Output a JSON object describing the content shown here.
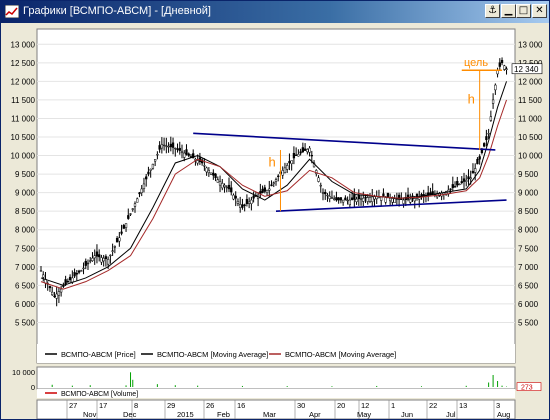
{
  "window": {
    "title": "Графики [ВСМПО-АВСМ] - [Дневной]",
    "buttons": [
      {
        "name": "pin-icon",
        "glyph": "⚓"
      },
      {
        "name": "minimize-icon",
        "glyph": "▁"
      },
      {
        "name": "maximize-icon",
        "glyph": "□"
      },
      {
        "name": "close-icon",
        "glyph": "✕"
      }
    ]
  },
  "colors": {
    "candle": "#000000",
    "ma_fast": "#000000",
    "ma_slow": "#a52a2a",
    "annotation_orange": "#ff8c00",
    "trendline": "#00008b",
    "axis": "#0000aa",
    "volume": "#00a000",
    "price_label_bg": "#ffffff"
  },
  "chart_data": [
    {
      "type": "line",
      "title": "",
      "xlabel": "",
      "ylabel": "",
      "ylim": [
        5000,
        13250
      ],
      "yticks": [
        "13 000",
        "12 500",
        "12 000",
        "11 500",
        "11 000",
        "10 500",
        "10 000",
        "9 500",
        "9 000",
        "8 500",
        "8 000",
        "7 500",
        "7 000",
        "6 500",
        "6 000",
        "5 500"
      ],
      "ytick_values": [
        13000,
        12500,
        12000,
        11500,
        11000,
        10500,
        10000,
        9500,
        9000,
        8500,
        8000,
        7500,
        7000,
        6500,
        6000,
        5500
      ],
      "last_price_label": "12 340",
      "last_price": 12340,
      "grid": true,
      "legend_position": "bottom",
      "series": [
        {
          "name": "ВСМПО-АВСМ [Price]",
          "kind": "candles",
          "x_index": [
            0,
            6,
            12,
            18,
            24,
            30,
            36,
            42,
            48,
            54,
            60,
            66,
            72,
            78,
            84,
            90,
            96,
            102,
            108,
            114,
            120,
            126,
            132,
            138,
            144,
            150,
            156,
            162,
            168,
            174,
            180,
            186,
            192,
            196,
            200,
            202,
            204,
            206,
            208
          ],
          "values": [
            6900,
            6200,
            6600,
            6900,
            7300,
            7200,
            7900,
            8700,
            9500,
            10300,
            10200,
            10000,
            9800,
            9400,
            9100,
            8600,
            8900,
            9100,
            9600,
            10000,
            10200,
            9000,
            8800,
            8800,
            8850,
            8900,
            8850,
            8800,
            8850,
            8950,
            9000,
            9200,
            9400,
            9900,
            10600,
            11500,
            12300,
            12500,
            12340
          ]
        },
        {
          "name": "ВСМПО-АВСМ [Moving Average]",
          "kind": "line",
          "x_index": [
            0,
            10,
            20,
            30,
            40,
            50,
            60,
            70,
            80,
            90,
            100,
            110,
            120,
            130,
            140,
            150,
            160,
            170,
            180,
            190,
            196,
            200,
            204,
            208
          ],
          "values": [
            6700,
            6500,
            6700,
            7000,
            7500,
            8600,
            9800,
            10000,
            9700,
            9100,
            8800,
            9200,
            9900,
            9300,
            8950,
            8900,
            8850,
            8900,
            9000,
            9100,
            9600,
            10400,
            11300,
            12000
          ]
        },
        {
          "name": "ВСМПО-АВСМ [Moving Average]",
          "kind": "line",
          "x_index": [
            0,
            10,
            20,
            30,
            40,
            50,
            60,
            70,
            80,
            90,
            100,
            110,
            120,
            130,
            140,
            150,
            160,
            170,
            180,
            190,
            196,
            200,
            204,
            208
          ],
          "values": [
            6600,
            6400,
            6600,
            6900,
            7300,
            8300,
            9500,
            9900,
            9700,
            9200,
            8900,
            9050,
            9600,
            9400,
            9000,
            8900,
            8850,
            8880,
            8950,
            9050,
            9400,
            10000,
            10800,
            11500
          ]
        }
      ],
      "annotations": {
        "upper_trendline": {
          "x": [
            68,
            203
          ],
          "y": [
            10600,
            10150
          ]
        },
        "lower_trendline": {
          "x": [
            105,
            208
          ],
          "y": [
            8500,
            8800
          ]
        },
        "h_label_left": "h",
        "h_left_line": {
          "x": 107,
          "y": [
            8500,
            10150
          ]
        },
        "h_label_right": "h",
        "h_right_line": {
          "x": 196,
          "y": [
            10150,
            12300
          ]
        },
        "target_label": "цель",
        "target_line": {
          "x": [
            188,
            206
          ],
          "y": 12300
        }
      },
      "x_categories_top": [
        "27",
        "17",
        "8",
        "29",
        "26",
        "16",
        "30",
        "20",
        "12",
        "1",
        "22",
        "13",
        "3"
      ],
      "x_categories_bottom": [
        "Nov",
        "Dec",
        "2015",
        "Feb",
        "Mar",
        "Apr",
        "May",
        "Jun",
        "Jul",
        "Aug"
      ]
    },
    {
      "type": "bar",
      "title": "",
      "series_label": "ВСМПО-АВСМ [Volume]",
      "yticks": [
        "10 000",
        "0"
      ],
      "ytick_values": [
        10000,
        0
      ],
      "ylim": [
        0,
        12000
      ],
      "last_value_label": "273",
      "x_index": [
        5,
        14,
        22,
        38,
        40,
        41,
        52,
        60,
        70,
        90,
        110,
        130,
        150,
        170,
        190,
        200,
        202,
        204,
        206,
        208
      ],
      "values": [
        1500,
        900,
        1200,
        1100,
        9800,
        4800,
        1900,
        1200,
        900,
        700,
        600,
        500,
        700,
        500,
        800,
        3000,
        8000,
        4000,
        900,
        273
      ]
    }
  ]
}
